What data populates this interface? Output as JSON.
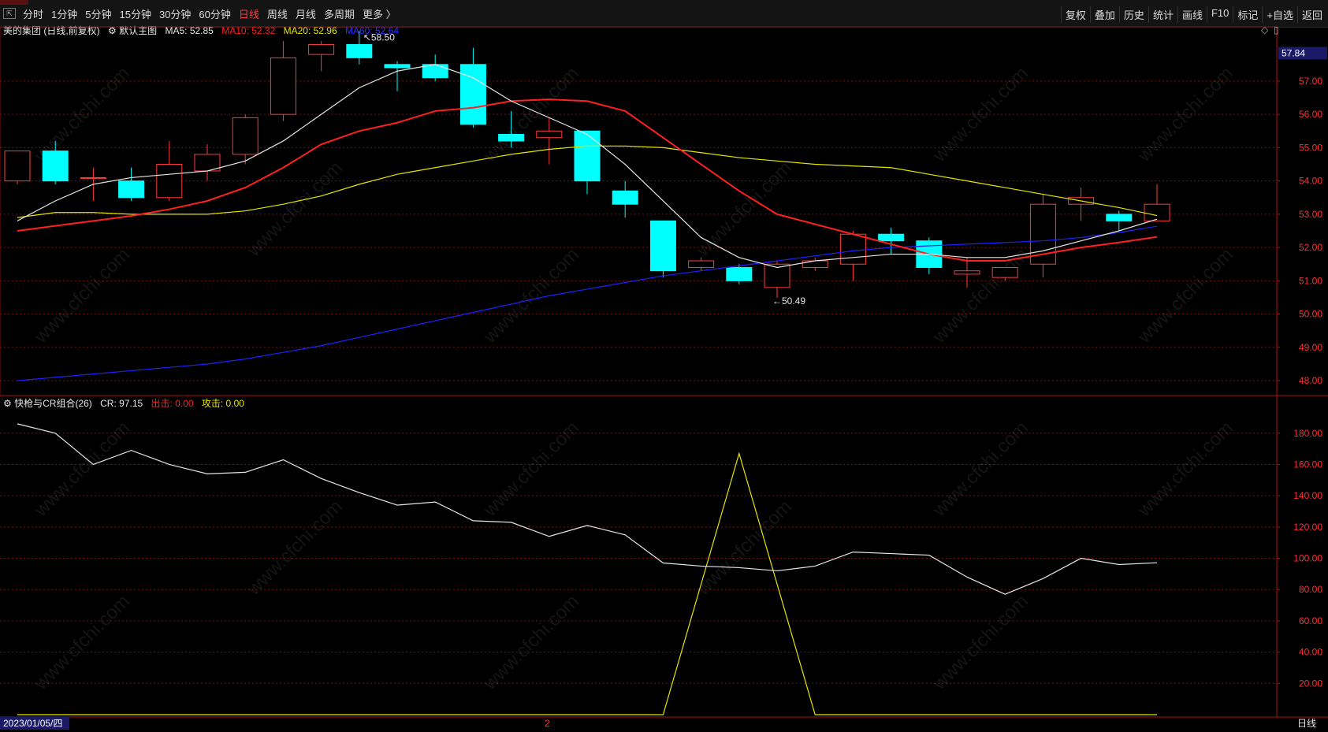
{
  "toolbar": {
    "left": [
      "分时",
      "1分钟",
      "5分钟",
      "15分钟",
      "30分钟",
      "60分钟",
      "日线",
      "周线",
      "月线",
      "多周期",
      "更多 〉"
    ],
    "active": "日线",
    "right": [
      "复权",
      "叠加",
      "历史",
      "统计",
      "画线",
      "F10",
      "标记",
      "+自选",
      "返回"
    ]
  },
  "main_legend": {
    "stock": "美的集团 (日线,前复权)",
    "indicator": "默认主图",
    "ma5": "MA5: 52.85",
    "ma10": "MA10: 52.32",
    "ma20": "MA20: 52.96",
    "ma60": "MA60: 52.64"
  },
  "sub_legend": {
    "name": "快枪与CR组合(26)",
    "cr": "CR: 97.15",
    "out": "出击: 0.00",
    "attack": "攻击: 0.00"
  },
  "watermark": "www.cfchi.com",
  "bottom": {
    "date": "2023/01/05/四",
    "marker": "2",
    "period": "日线"
  },
  "colors": {
    "up": "#ff3b3b",
    "down": "#00ffff",
    "ma5": "#e6e6e6",
    "ma10": "#ff2020",
    "ma20": "#e6e600",
    "ma60": "#2020ff",
    "grid": "#7a1010",
    "cr": "#e6e6e6",
    "signal": "#e6e600"
  },
  "chart_data": [
    {
      "type": "candlestick",
      "ylim": [
        47.6,
        58.3
      ],
      "yticks": [
        "48.00",
        "49.00",
        "50.00",
        "51.00",
        "52.00",
        "53.00",
        "54.00",
        "55.00",
        "56.00",
        "57.00"
      ],
      "current_price": "57.84",
      "high_label": "58.50",
      "low_label": "50.49",
      "ohlc": [
        [
          54.0,
          54.9,
          53.9,
          54.9
        ],
        [
          54.9,
          55.2,
          53.9,
          54.0
        ],
        [
          54.1,
          54.4,
          53.4,
          54.1
        ],
        [
          54.0,
          54.4,
          53.4,
          53.5
        ],
        [
          53.5,
          55.2,
          53.4,
          54.5
        ],
        [
          54.3,
          55.1,
          54.0,
          54.8
        ],
        [
          54.8,
          56.0,
          54.5,
          55.9
        ],
        [
          56.0,
          58.2,
          55.8,
          57.7
        ],
        [
          57.8,
          58.2,
          57.3,
          58.1
        ],
        [
          58.1,
          58.5,
          57.5,
          57.7
        ],
        [
          57.5,
          57.6,
          56.7,
          57.4
        ],
        [
          57.5,
          57.8,
          57.0,
          57.1
        ],
        [
          57.5,
          58.0,
          55.6,
          55.7
        ],
        [
          55.4,
          56.1,
          55.0,
          55.2
        ],
        [
          55.3,
          55.9,
          54.5,
          55.5
        ],
        [
          55.5,
          55.5,
          53.6,
          54.0
        ],
        [
          53.7,
          54.0,
          52.9,
          53.3
        ],
        [
          52.8,
          52.8,
          51.1,
          51.3
        ],
        [
          51.4,
          51.7,
          51.3,
          51.6
        ],
        [
          51.4,
          51.5,
          50.9,
          51.0
        ],
        [
          50.8,
          51.6,
          50.49,
          51.5
        ],
        [
          51.4,
          51.7,
          51.3,
          51.6
        ],
        [
          51.5,
          52.5,
          51.0,
          52.4
        ],
        [
          52.4,
          52.6,
          51.8,
          52.2
        ],
        [
          52.2,
          52.3,
          51.2,
          51.4
        ],
        [
          51.2,
          51.7,
          50.8,
          51.3
        ],
        [
          51.1,
          51.4,
          51.0,
          51.4
        ],
        [
          51.5,
          53.6,
          51.1,
          53.3
        ],
        [
          53.3,
          53.8,
          52.8,
          53.5
        ],
        [
          53.0,
          53.1,
          52.5,
          52.8
        ],
        [
          52.8,
          53.9,
          52.8,
          53.3
        ]
      ],
      "ma5": [
        52.8,
        53.4,
        53.9,
        54.1,
        54.2,
        54.3,
        54.6,
        55.2,
        56.0,
        56.8,
        57.3,
        57.5,
        57.1,
        56.4,
        55.9,
        55.4,
        54.5,
        53.4,
        52.3,
        51.7,
        51.4,
        51.6,
        51.7,
        51.8,
        51.8,
        51.7,
        51.7,
        51.9,
        52.2,
        52.5,
        52.85
      ],
      "ma10": [
        52.5,
        52.65,
        52.8,
        52.95,
        53.15,
        53.4,
        53.8,
        54.4,
        55.1,
        55.5,
        55.75,
        56.1,
        56.2,
        56.4,
        56.45,
        56.4,
        56.1,
        55.3,
        54.5,
        53.7,
        53.0,
        52.7,
        52.4,
        52.1,
        51.8,
        51.6,
        51.6,
        51.8,
        52.0,
        52.15,
        52.32
      ],
      "ma20": [
        52.9,
        53.05,
        53.05,
        53.0,
        53.0,
        53.0,
        53.1,
        53.3,
        53.55,
        53.9,
        54.2,
        54.4,
        54.6,
        54.8,
        54.95,
        55.05,
        55.05,
        55.0,
        54.85,
        54.7,
        54.6,
        54.5,
        54.45,
        54.4,
        54.2,
        54.0,
        53.8,
        53.6,
        53.4,
        53.2,
        52.96
      ],
      "ma60": [
        48.0,
        48.1,
        48.2,
        48.3,
        48.4,
        48.5,
        48.65,
        48.85,
        49.05,
        49.3,
        49.55,
        49.8,
        50.05,
        50.3,
        50.55,
        50.75,
        50.95,
        51.15,
        51.3,
        51.45,
        51.6,
        51.75,
        51.9,
        52.0,
        52.05,
        52.1,
        52.15,
        52.2,
        52.3,
        52.45,
        52.64
      ]
    },
    {
      "type": "line",
      "ylim": [
        0,
        195
      ],
      "yticks": [
        "20.00",
        "40.00",
        "60.00",
        "80.00",
        "100.00",
        "120.00",
        "140.00",
        "160.00",
        "180.00"
      ],
      "cr_x": [
        0,
        1,
        2,
        3,
        4,
        5,
        6,
        7,
        8,
        9,
        10,
        11,
        12,
        13,
        14,
        15,
        16,
        17,
        18,
        19,
        20,
        21,
        22,
        23,
        24,
        25,
        26,
        27,
        28,
        29,
        30
      ],
      "cr": [
        186,
        180,
        160,
        169,
        160,
        154,
        155,
        163,
        151,
        142,
        134,
        136,
        124,
        123,
        114,
        121,
        115,
        97,
        95,
        94,
        92,
        95,
        104,
        103,
        102,
        88,
        77,
        87,
        100,
        96,
        97.15
      ],
      "signal_x": [
        0,
        17,
        19,
        21,
        30
      ],
      "signal": [
        0,
        0,
        167,
        0,
        0
      ]
    }
  ]
}
